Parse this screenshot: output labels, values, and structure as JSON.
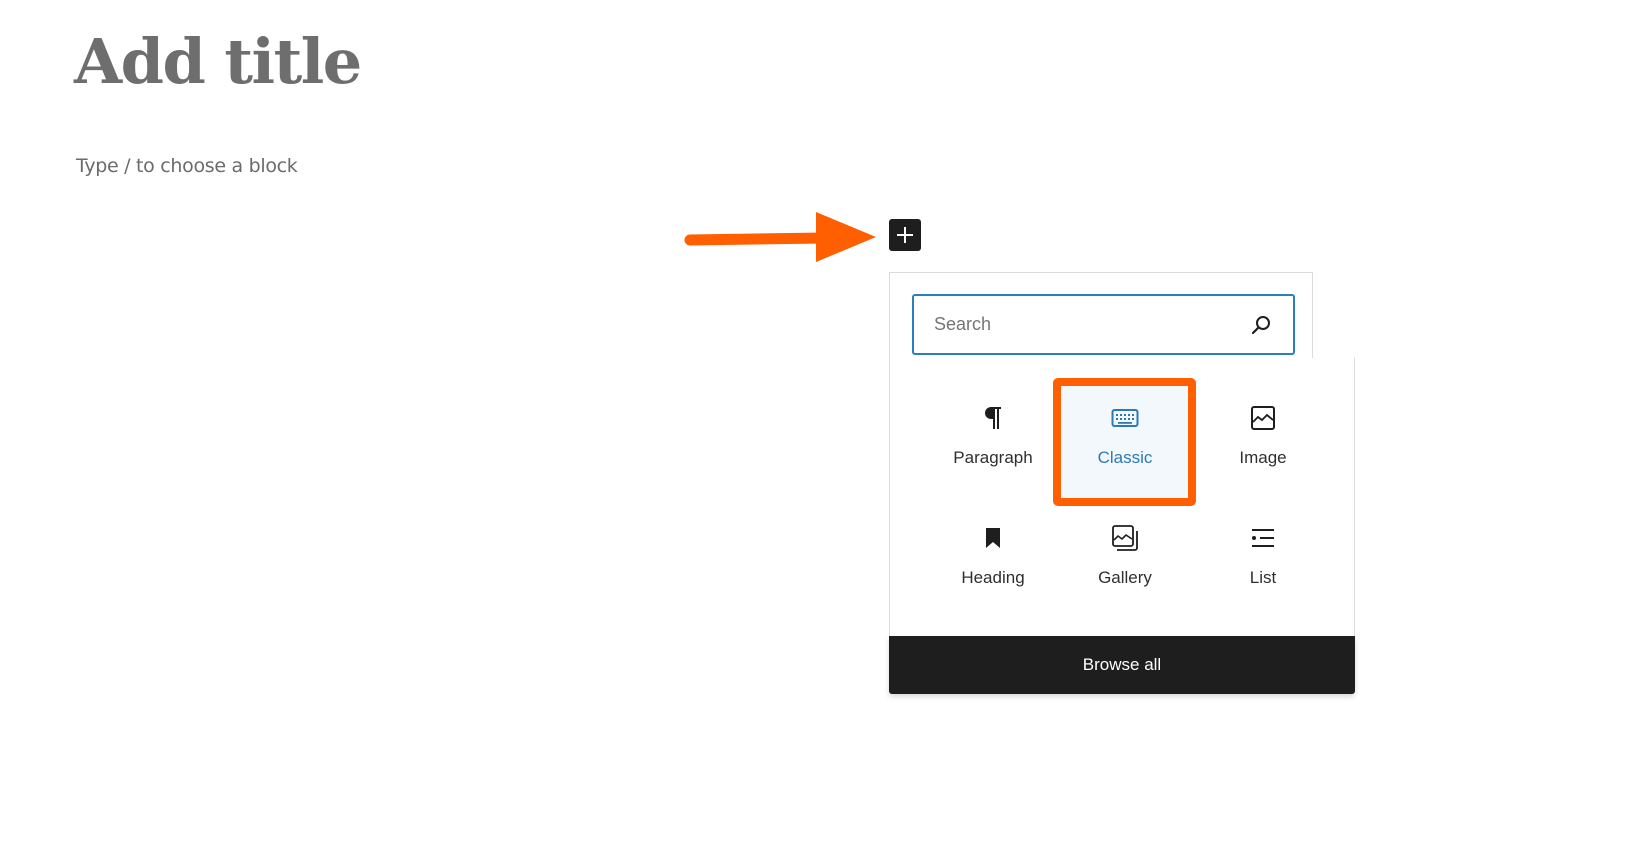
{
  "editor": {
    "title_placeholder": "Add title",
    "block_placeholder": "Type / to choose a block"
  },
  "annotation": {
    "arrow_color": "#ff5f00",
    "highlight_color": "#ff5f00",
    "highlighted_block": "Classic"
  },
  "inserter": {
    "toggle_icon": "plus-icon",
    "search": {
      "placeholder": "Search",
      "value": "",
      "icon": "search-icon"
    },
    "blocks": [
      {
        "label": "Paragraph",
        "icon": "paragraph-icon"
      },
      {
        "label": "Classic",
        "icon": "keyboard-icon",
        "selected": true
      },
      {
        "label": "Image",
        "icon": "image-icon"
      },
      {
        "label": "Heading",
        "icon": "bookmark-icon"
      },
      {
        "label": "Gallery",
        "icon": "gallery-icon"
      },
      {
        "label": "List",
        "icon": "list-icon"
      }
    ],
    "browse_all_label": "Browse all",
    "accent_color": "#2c79b5"
  }
}
